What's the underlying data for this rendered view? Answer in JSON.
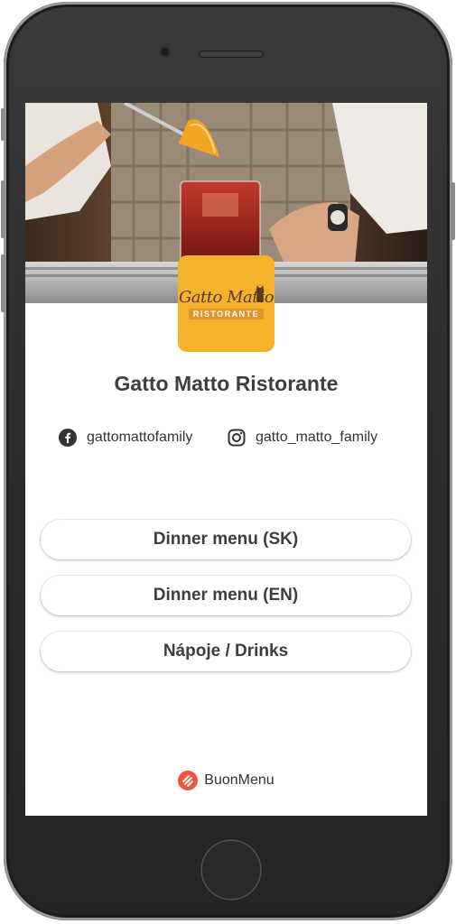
{
  "restaurant": {
    "name": "Gatto Matto Ristorante",
    "logo_main": "Gatto Matto",
    "logo_sub": "RISTORANTE"
  },
  "social": {
    "facebook": {
      "icon": "facebook-icon",
      "handle": "gattomattofamily"
    },
    "instagram": {
      "icon": "instagram-icon",
      "handle": "gatto_matto_family"
    }
  },
  "menus": [
    {
      "label": "Dinner menu (SK)"
    },
    {
      "label": "Dinner menu (EN)"
    },
    {
      "label": "Nápoje / Drinks"
    }
  ],
  "footer": {
    "brand": "BuonMenu",
    "icon": "buonmenu-logo-icon"
  },
  "colors": {
    "logo_bg": "#f5b32b",
    "brand_accent": "#f0543c",
    "text": "#3f3f3f"
  }
}
